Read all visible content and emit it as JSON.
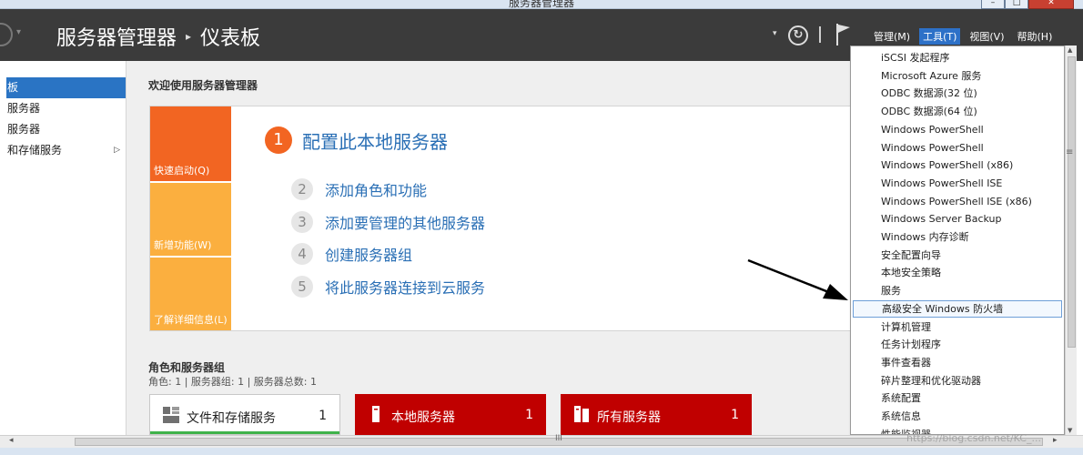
{
  "window": {
    "title": "服务器管理器",
    "min_icon": "minimize-icon",
    "max_icon": "maximize-icon",
    "close_icon": "close-icon",
    "min_label": "–",
    "max_label": "□",
    "close_label": "✕"
  },
  "header": {
    "breadcrumb_app": "服务器管理器",
    "breadcrumb_sep": "▸",
    "breadcrumb_page": "仪表板",
    "menus": [
      {
        "label": "管理(M)",
        "active": false
      },
      {
        "label": "工具(T)",
        "active": true
      },
      {
        "label": "视图(V)",
        "active": false
      },
      {
        "label": "帮助(H)",
        "active": false
      }
    ],
    "refresh_label": "↻",
    "dropdown_arrow": "▾",
    "header_bg": "#3b3b3b",
    "active_menu_bg": "#2d71c8"
  },
  "sidebar": {
    "items": [
      {
        "label": "板",
        "active": true
      },
      {
        "label": "服务器",
        "active": false
      },
      {
        "label": "服务器",
        "active": false
      },
      {
        "label": "和存储服务",
        "active": false,
        "has_arrow": true
      }
    ],
    "arrow": "▷"
  },
  "main": {
    "welcome": "欢迎使用服务器管理器",
    "tiles": [
      "快速启动(Q)",
      "新增功能(W)",
      "了解详细信息(L)"
    ],
    "primary_step": {
      "num": "1",
      "label": "配置此本地服务器"
    },
    "steps": [
      {
        "num": "2",
        "label": "添加角色和功能"
      },
      {
        "num": "3",
        "label": "添加要管理的其他服务器"
      },
      {
        "num": "4",
        "label": "创建服务器组"
      },
      {
        "num": "5",
        "label": "将此服务器连接到云服务"
      }
    ],
    "roles_title": "角色和服务器组",
    "roles_sub": "角色: 1 | 服务器组: 1 | 服务器总数: 1",
    "cards": [
      {
        "name": "文件和存储服务",
        "count": "1",
        "icon": "file-storage-icon"
      },
      {
        "name": "本地服务器",
        "count": "1",
        "icon": "server-icon"
      },
      {
        "name": "所有服务器",
        "count": "1",
        "icon": "servers-icon"
      }
    ],
    "colors": {
      "accent_orange": "#f26522",
      "tile_yellow": "#fbaf3f",
      "link_blue": "#2a6fb5",
      "card_red": "#c00000",
      "status_green": "#3fb24a"
    }
  },
  "tools_menu": {
    "items": [
      "iSCSI 发起程序",
      "Microsoft Azure 服务",
      "ODBC 数据源(32 位)",
      "ODBC 数据源(64 位)",
      "Windows PowerShell",
      "Windows PowerShell",
      "Windows PowerShell (x86)",
      "Windows PowerShell ISE",
      "Windows PowerShell ISE (x86)",
      "Windows Server Backup",
      "Windows 内存诊断",
      "安全配置向导",
      "本地安全策略",
      "服务",
      "高级安全 Windows 防火墙",
      "计算机管理",
      "任务计划程序",
      "事件查看器",
      "碎片整理和优化驱动器",
      "系统配置",
      "系统信息",
      "性能监视器"
    ],
    "highlighted": "高级安全 Windows 防火墙"
  },
  "scroll": {
    "up": "▲",
    "down": "▼",
    "left": "◂",
    "right": "▸",
    "grip": "III",
    "side_grip": "≡"
  },
  "watermark": "https://blog.csdn.net/KC_..."
}
